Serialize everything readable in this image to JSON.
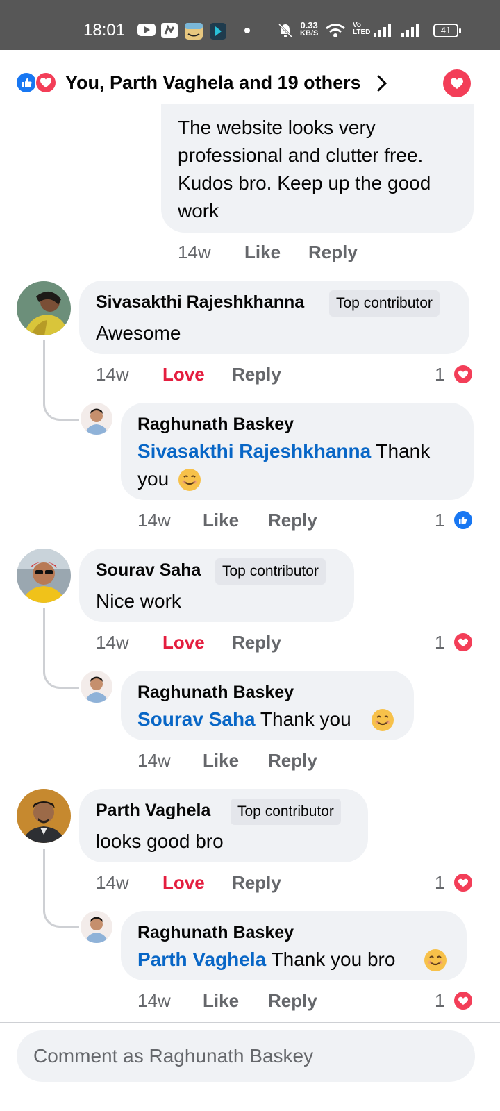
{
  "status_bar": {
    "time": "18:01",
    "net_speed_top": "0.33",
    "net_speed_bottom": "KB/S",
    "volte_top": "Vo",
    "volte_bottom": "LTED",
    "battery": "41"
  },
  "reactions_header": {
    "summary": "You, Parth Vaghela and 19 others"
  },
  "top_comment": {
    "lines": [
      "The website looks very",
      "professional and clutter free.",
      "Kudos bro. Keep up the good",
      "work"
    ],
    "time": "14w",
    "like": "Like",
    "reply": "Reply"
  },
  "comments": [
    {
      "name": "Sivasakthi Rajeshkhanna",
      "badge": "Top contributor",
      "text": "Awesome",
      "time": "14w",
      "reaction_label": "Love",
      "reply": "Reply",
      "reaction_count": "1",
      "reaction_icon": "heart-icon",
      "reply_item": {
        "name": "Raghunath Baskey",
        "mention": "Sivasakthi Rajeshkhanna",
        "text_line1": " Thank",
        "text_line2": "you",
        "emoji": "smiling-emoji",
        "time": "14w",
        "like": "Like",
        "reply": "Reply",
        "reaction_count": "1",
        "reaction_icon": "thumbs-up-icon"
      }
    },
    {
      "name": "Sourav Saha",
      "badge": "Top contributor",
      "text": "Nice work",
      "time": "14w",
      "reaction_label": "Love",
      "reply": "Reply",
      "reaction_count": "1",
      "reaction_icon": "heart-icon",
      "reply_item": {
        "name": "Raghunath Baskey",
        "mention": "Sourav Saha",
        "text": " Thank you",
        "emoji": "smiling-emoji",
        "time": "14w",
        "like": "Like",
        "reply": "Reply"
      }
    },
    {
      "name": "Parth Vaghela",
      "badge": "Top contributor",
      "text": "looks good bro",
      "time": "14w",
      "reaction_label": "Love",
      "reply": "Reply",
      "reaction_count": "1",
      "reaction_icon": "heart-icon",
      "reply_item": {
        "name": "Raghunath Baskey",
        "mention": "Parth Vaghela",
        "text": " Thank you bro",
        "emoji": "smiling-emoji",
        "time": "14w",
        "like": "Like",
        "reply": "Reply",
        "reaction_count": "1",
        "reaction_icon": "heart-icon"
      }
    }
  ],
  "composer": {
    "placeholder": "Comment as Raghunath Baskey"
  },
  "colors": {
    "status_bar": "#575757",
    "bubble": "#f0f2f5",
    "mention": "#0866c6",
    "love": "#e41e3f",
    "like_blue": "#1877f2",
    "meta_gray": "#65676b"
  }
}
